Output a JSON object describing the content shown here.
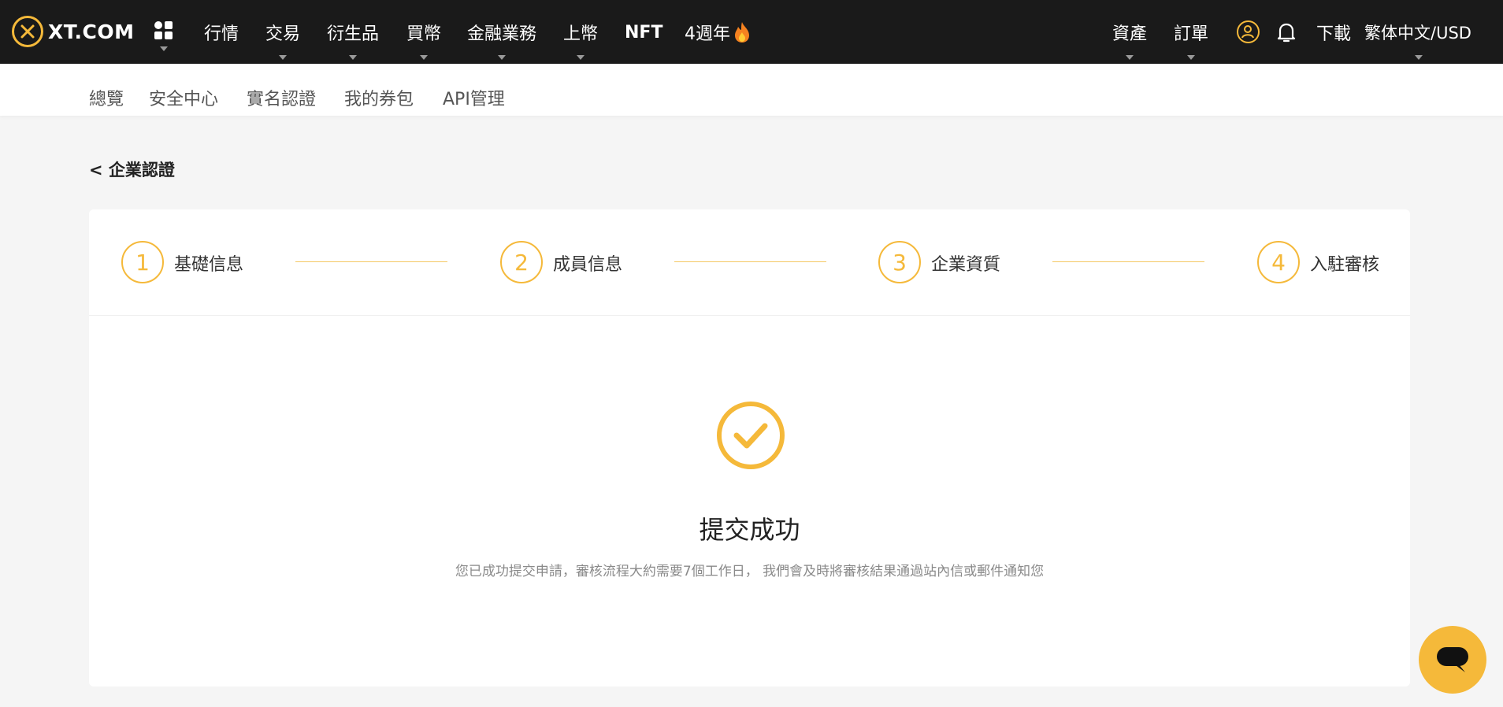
{
  "brand": {
    "name": "XT.COM",
    "accent": "#f5b93a"
  },
  "topnav": {
    "items": [
      {
        "label": "行情"
      },
      {
        "label": "交易"
      },
      {
        "label": "衍生品"
      },
      {
        "label": "買幣"
      },
      {
        "label": "金融業務"
      },
      {
        "label": "上幣"
      },
      {
        "label": "NFT"
      },
      {
        "label": "4週年"
      }
    ],
    "right": {
      "assets": "資產",
      "orders": "訂單",
      "download": "下載",
      "language": "繁体中文/USD"
    },
    "icons": [
      "apps-icon",
      "user-icon",
      "bell-icon",
      "fire-icon"
    ]
  },
  "subnav": {
    "items": [
      {
        "label": "總覽"
      },
      {
        "label": "安全中心"
      },
      {
        "label": "實名認證"
      },
      {
        "label": "我的券包"
      },
      {
        "label": "API管理"
      }
    ]
  },
  "page": {
    "back_label": "< 企業認證"
  },
  "steps": [
    {
      "number": "1",
      "label": "基礎信息"
    },
    {
      "number": "2",
      "label": "成員信息"
    },
    {
      "number": "3",
      "label": "企業資質"
    },
    {
      "number": "4",
      "label": "入駐審核"
    }
  ],
  "result": {
    "icon": "check-circle-icon",
    "title": "提交成功",
    "description": "您已成功提交申請，審核流程大約需要7個工作日， 我們會及時將審核結果通過站內信或郵件通知您"
  },
  "chat": {
    "icon": "chat-bubble-icon"
  }
}
